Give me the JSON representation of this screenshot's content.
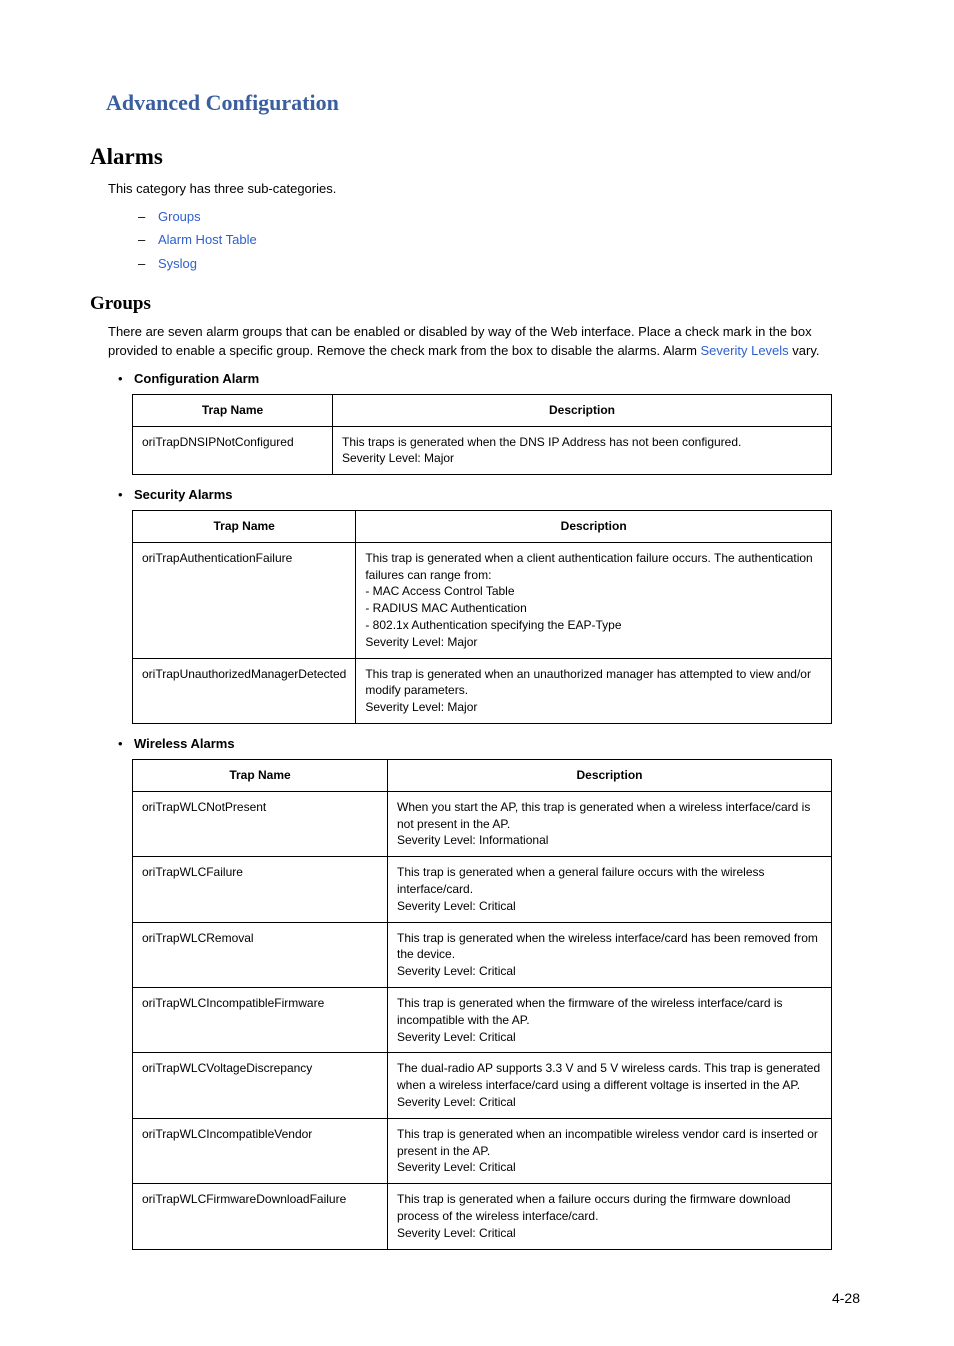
{
  "chapterTitle": "Advanced Configuration",
  "section": {
    "title": "Alarms",
    "intro": "This category has three sub-categories.",
    "subcats": [
      {
        "label": "Groups"
      },
      {
        "label": "Alarm Host Table"
      },
      {
        "label": "Syslog"
      }
    ]
  },
  "groups": {
    "title": "Groups",
    "intro_a": "There are seven alarm groups that can be enabled or disabled by way of the Web interface. Place a check mark in the box provided to enable a specific group. Remove the check mark from the box to disable the alarms. Alarm ",
    "intro_link": "Severity Levels",
    "intro_b": " vary."
  },
  "th_trap": "Trap Name",
  "th_desc": "Description",
  "configAlarm": {
    "label": "Configuration Alarm",
    "rows": [
      {
        "name": "oriTrapDNSIPNotConfigured",
        "desc": "This traps is generated when the DNS IP Address has not been configured.\nSeverity Level: Major"
      }
    ]
  },
  "securityAlarms": {
    "label": "Security Alarms",
    "rows": [
      {
        "name": "oriTrapAuthenticationFailure",
        "desc": "This trap is generated when a client authentication failure occurs. The authentication failures can range from:\n- MAC Access Control Table\n- RADIUS MAC Authentication\n- 802.1x Authentication specifying the EAP-Type\nSeverity Level: Major"
      },
      {
        "name": "oriTrapUnauthorizedManagerDetected",
        "desc": "This trap is generated when an unauthorized manager has attempted to view and/or modify parameters.\nSeverity Level: Major"
      }
    ]
  },
  "wirelessAlarms": {
    "label": "Wireless Alarms",
    "rows": [
      {
        "name": "oriTrapWLCNotPresent",
        "desc": "When you start the AP, this trap is generated when a wireless interface/card is not present in the AP.\nSeverity Level: Informational"
      },
      {
        "name": "oriTrapWLCFailure",
        "desc": "This trap is generated when a general failure occurs with the wireless interface/card.\nSeverity Level: Critical"
      },
      {
        "name": "oriTrapWLCRemoval",
        "desc": "This trap is generated when the wireless interface/card has been removed from the device.\nSeverity Level: Critical"
      },
      {
        "name": "oriTrapWLCIncompatibleFirmware",
        "desc": "This trap is generated when the firmware of the wireless interface/card is incompatible with the AP.\nSeverity Level: Critical"
      },
      {
        "name": "oriTrapWLCVoltageDiscrepancy",
        "desc": "The dual-radio AP supports 3.3 V and 5 V wireless cards.  This trap is generated when a wireless interface/card using a different voltage is inserted in the AP.\nSeverity Level: Critical"
      },
      {
        "name": "oriTrapWLCIncompatibleVendor",
        "desc": "This trap is generated when an incompatible wireless vendor card is inserted or present in the AP.\nSeverity Level: Critical"
      },
      {
        "name": "oriTrapWLCFirmwareDownloadFailure",
        "desc": "This trap is generated when a failure occurs during the firmware download process of the wireless interface/card.\nSeverity Level: Critical"
      }
    ]
  },
  "pageNum": "4-28"
}
